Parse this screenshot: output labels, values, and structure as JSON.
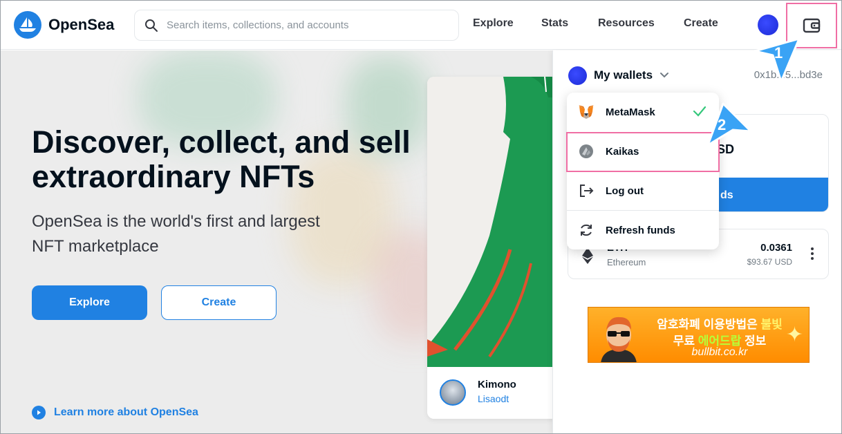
{
  "app": {
    "name": "OpenSea"
  },
  "header": {
    "search_placeholder": "Search items, collections, and accounts",
    "nav": [
      "Explore",
      "Stats",
      "Resources",
      "Create"
    ]
  },
  "hero": {
    "title": "Discover, collect, and sell extraordinary NFTs",
    "subtitle": "OpenSea is the world's first and largest NFT marketplace",
    "explore_label": "Explore",
    "create_label": "Create",
    "learn_more": "Learn more about OpenSea"
  },
  "featured": {
    "name": "Kimono",
    "author": "Lisaodt"
  },
  "wallet_panel": {
    "title": "My wallets",
    "address": "0x1b...5...bd3e",
    "balance_usd_fragment": "SD",
    "add_funds_fragment": "ds",
    "token": {
      "symbol_fragment": "ETH",
      "name": "Ethereum",
      "amount": "0.0361",
      "usd": "$93.67 USD"
    }
  },
  "dropdown": {
    "items": [
      {
        "label": "MetaMask",
        "icon": "metamask-fox-icon",
        "selected": true
      },
      {
        "label": "Kaikas",
        "icon": "kaikas-icon",
        "selected": false
      },
      {
        "label": "Log out",
        "icon": "logout-icon"
      },
      {
        "label": "Refresh funds",
        "icon": "refresh-icon"
      }
    ]
  },
  "ad": {
    "line1_a": "암호화폐 이용방법은 ",
    "line1_b": "불빛",
    "line2_a": "무료 ",
    "line2_b": "에어드랍",
    "line2_c": " 정보",
    "domain": "bullbit.co.kr"
  },
  "markers": [
    "1",
    "2"
  ],
  "colors": {
    "primary": "#2081e2",
    "highlight": "#f06ea4",
    "ad_orange": "#ff9a00"
  }
}
